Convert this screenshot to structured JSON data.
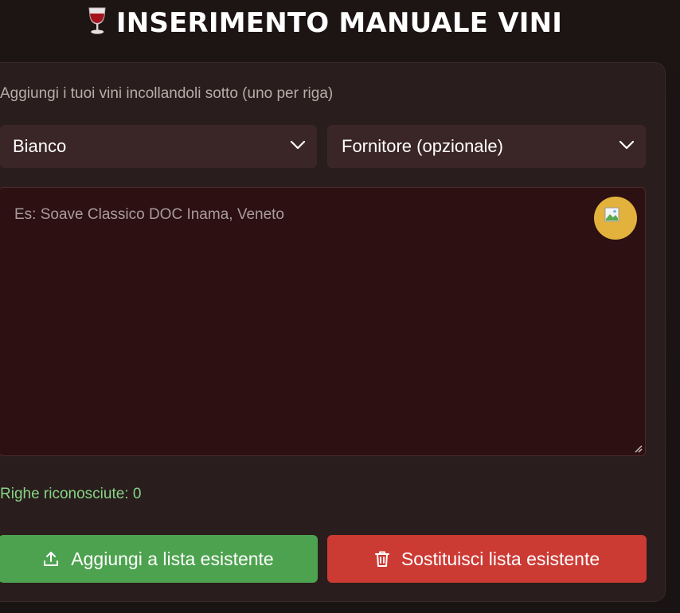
{
  "header": {
    "emoji": "🍷",
    "title": "INSERIMENTO MANUALE VINI"
  },
  "form": {
    "instructions": "Aggiungi i tuoi vini incollandoli sotto (uno per riga)",
    "wine_type": {
      "selected": "Bianco"
    },
    "supplier": {
      "selected": "Fornitore (opzionale)"
    },
    "wine_list": {
      "placeholder": "Es: Soave Classico DOC Inama, Veneto",
      "value": ""
    },
    "recognized_rows": "Righe riconosciute: 0",
    "add_button": "Aggiungi a lista esistente",
    "replace_button": "Sostituisci lista esistente"
  },
  "icons": {
    "wine-glass": "wine-glass-icon",
    "chevron": "chevron-down-icon",
    "image-placeholder": "broken-image-icon",
    "upload": "upload-icon",
    "trash": "trash-icon"
  },
  "colors": {
    "background": "#1a1212",
    "card": "#2a1d1d",
    "select": "#3b2627",
    "textarea": "#2c1012",
    "mic_button": "#e2b23c",
    "status_text": "#86d586",
    "add_button": "#4da24f",
    "replace_button": "#cc3a34"
  }
}
